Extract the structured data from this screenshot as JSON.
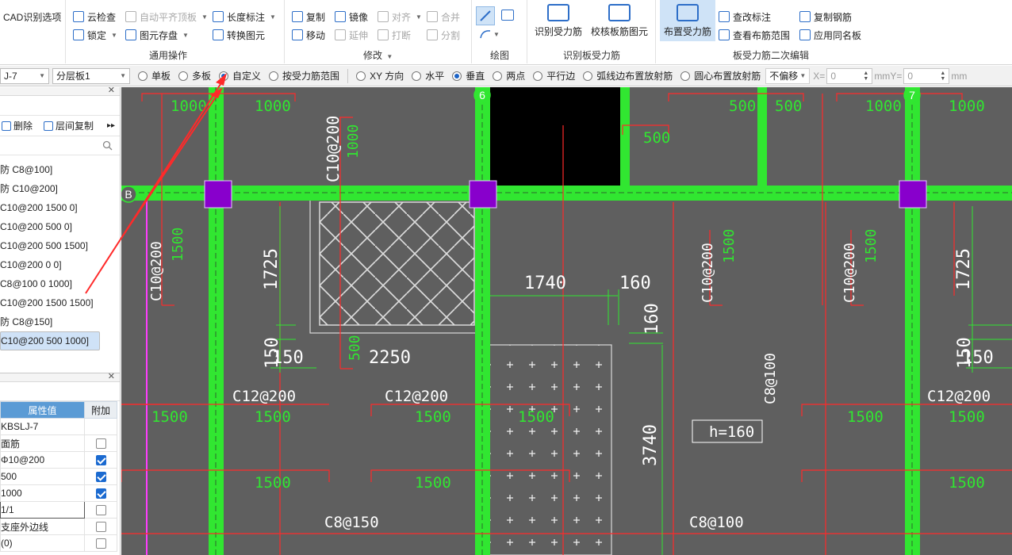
{
  "ribbon": {
    "col1": {
      "item1": "CAD识别选项"
    },
    "col2": {
      "cloud_check": "云检查",
      "lock": "锁定"
    },
    "col3": {
      "auto_align": "自动平齐顶板",
      "save_figure": "图元存盘"
    },
    "col4": {
      "length_dim": "长度标注",
      "convert_figure": "转换图元"
    },
    "modify": {
      "copy": "复制",
      "mirror": "镜像",
      "move": "移动",
      "align": "对齐",
      "extend": "延伸",
      "break": "打断",
      "merge": "合并",
      "split": "分割"
    },
    "big_buttons": {
      "identify": "识别受力筋",
      "verify": "校核板筋图元",
      "layout": "布置受力筋"
    },
    "secondary": {
      "check_mark": "查改标注",
      "view_range": "查看布筋范围",
      "copy_rebar": "复制钢筋",
      "apply_same": "应用同名板"
    },
    "groups": {
      "general": "通用操作",
      "modify": "修改",
      "draw": "绘图",
      "identify": "识别板受力筋",
      "edit": "板受力筋二次编辑"
    }
  },
  "optbar": {
    "member": "J-7",
    "layer": "分层板1",
    "radios": [
      "单板",
      "多板",
      "自定义",
      "按受力筋范围",
      "XY 方向",
      "水平",
      "垂直",
      "两点",
      "平行边",
      "弧线边布置放射筋",
      "圆心布置放射筋"
    ],
    "offset": "不偏移",
    "x_label": "X=",
    "x_value": "0",
    "y_label": "Y=",
    "y_value": "0",
    "unit": "mm"
  },
  "left_panel": {
    "delete": "删除",
    "copy_between_floors": "层间复制",
    "items": [
      "防 C8@100]",
      "防 C10@200]",
      "C10@200 1500 0]",
      "C10@200 500 0]",
      "C10@200 500 1500]",
      "C10@200 0 0]",
      "C8@100 0 1000]",
      "C10@200 1500 1500]",
      "防 C8@150]",
      "C10@200 500 1000]"
    ],
    "selected_index": 9
  },
  "prop_panel": {
    "header_value": "属性值",
    "header_add": "附加",
    "rows": [
      {
        "value": "KBSLJ-7",
        "check": null
      },
      {
        "value": "面筋",
        "check": false
      },
      {
        "value": "Φ10@200",
        "check": true
      },
      {
        "value": "500",
        "check": true
      },
      {
        "value": "1000",
        "check": true
      },
      {
        "value": "1/1",
        "check": false
      },
      {
        "value": "支座外边线",
        "check": false
      },
      {
        "value": "(0)",
        "check": false
      }
    ]
  },
  "canvas": {
    "axes": {
      "b": "B",
      "six": "6",
      "seven": "7"
    },
    "top_labels": [
      "1000",
      "1000",
      "500",
      "500",
      "1000",
      "1000"
    ],
    "texts": {
      "t500a": "500",
      "c10": "C10@200",
      "t1000v": "1000",
      "t1725": "1725",
      "t1740": "1740",
      "t160a": "160",
      "t160b": "160",
      "t150a": "150",
      "t150b": "150",
      "t500b": "500",
      "t2250": "2250",
      "c12a": "C12@200",
      "c12b": "C12@200",
      "c12c": "C12@200",
      "c8_100v": "C8@100",
      "h160": "h=160",
      "t3740": "3740",
      "c8_150": "C8@150",
      "c8_100": "C8@100",
      "c10v1": "C10@200",
      "c10v2": "C10@200",
      "c10v3": "C10@200",
      "v1500a": "1500",
      "v1500b": "1500",
      "v1500c": "1500",
      "t1725b": "1725",
      "r1500": [
        "1500",
        "1500",
        "1500",
        "1500",
        "1500",
        "1500",
        "1500"
      ],
      "r1500b": [
        "1500",
        "1500",
        "1500"
      ]
    }
  },
  "colors": {
    "beam": "#31e631",
    "column": "#8800cc",
    "canvas": "#5f5f5f",
    "rebar_red": "#ff2a2a",
    "annotation": "#ff2a2a"
  }
}
